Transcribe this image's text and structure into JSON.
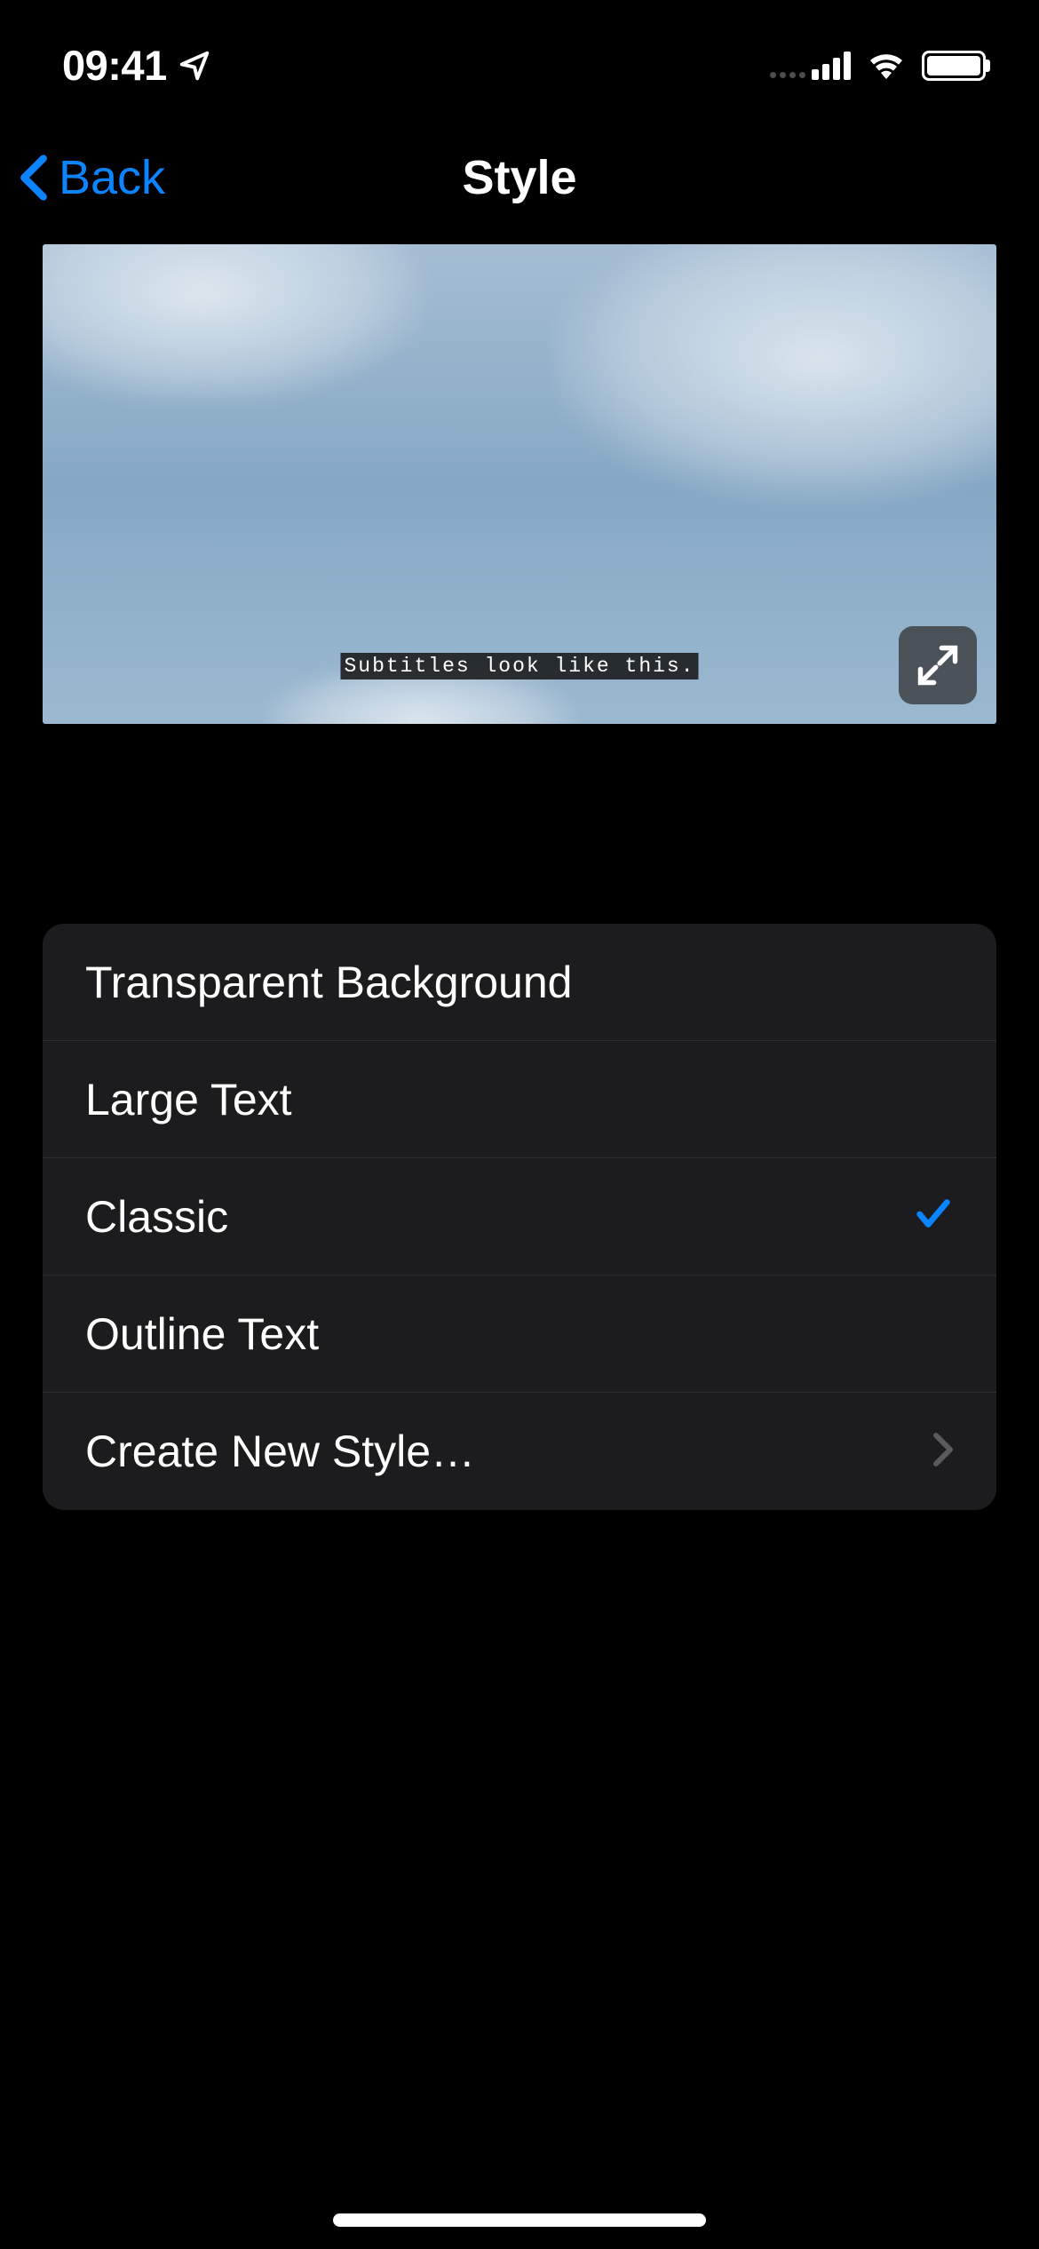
{
  "status_bar": {
    "time": "09:41"
  },
  "nav": {
    "back_label": "Back",
    "title": "Style"
  },
  "preview": {
    "subtitle_text": "Subtitles look like this."
  },
  "style_options": [
    {
      "label": "Transparent Background",
      "selected": false
    },
    {
      "label": "Large Text",
      "selected": false
    },
    {
      "label": "Classic",
      "selected": true
    },
    {
      "label": "Outline Text",
      "selected": false
    }
  ],
  "create_new_label": "Create New Style…",
  "colors": {
    "accent": "#0A84FF",
    "background": "#000000",
    "card": "#1c1c1e"
  }
}
